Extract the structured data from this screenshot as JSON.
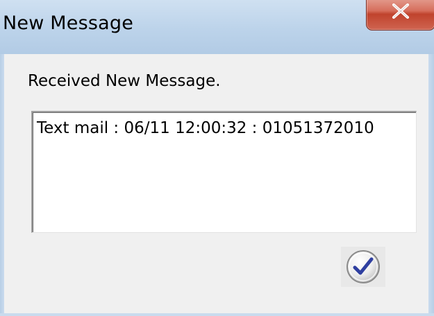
{
  "window": {
    "title": "New Message"
  },
  "dialog": {
    "prompt": "Received New Message.",
    "message_text": "Text mail : 06/11 12:00:32 : 01051372010"
  },
  "icons": {
    "close": "close-icon",
    "confirm": "checkmark-icon"
  },
  "colors": {
    "titlebar": "#c3d7ec",
    "close_button": "#c9503b",
    "checkmark": "#2f3fa0",
    "background": "#f0f0f0"
  }
}
